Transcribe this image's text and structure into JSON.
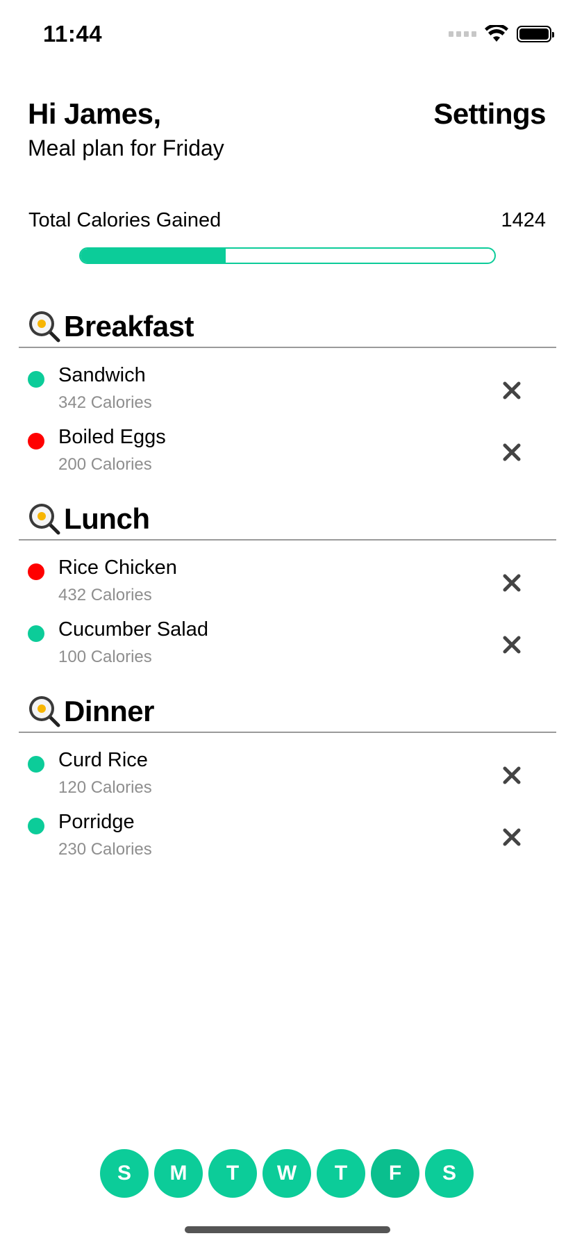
{
  "status_bar": {
    "time": "11:44"
  },
  "header": {
    "greeting": "Hi James,",
    "subtitle": "Meal plan for Friday",
    "settings_label": "Settings"
  },
  "calories": {
    "label": "Total Calories Gained",
    "value": "1424",
    "progress_percent": 35
  },
  "sections": [
    {
      "title": "Breakfast",
      "icon": "frying-pan-egg-icon",
      "items": [
        {
          "name": "Sandwich",
          "calories": "342 Calories",
          "status": "green"
        },
        {
          "name": "Boiled Eggs",
          "calories": "200 Calories",
          "status": "red"
        }
      ]
    },
    {
      "title": "Lunch",
      "icon": "frying-pan-egg-icon",
      "items": [
        {
          "name": "Rice Chicken",
          "calories": "432 Calories",
          "status": "red"
        },
        {
          "name": "Cucumber Salad",
          "calories": "100 Calories",
          "status": "green"
        }
      ]
    },
    {
      "title": "Dinner",
      "icon": "frying-pan-egg-icon",
      "items": [
        {
          "name": "Curd Rice",
          "calories": "120 Calories",
          "status": "green"
        },
        {
          "name": "Porridge",
          "calories": "230 Calories",
          "status": "green"
        }
      ]
    }
  ],
  "days": [
    "S",
    "M",
    "T",
    "W",
    "T",
    "F",
    "S"
  ],
  "selected_day_index": 5,
  "colors": {
    "accent": "#0ccc99",
    "green": "#0ccc99",
    "red": "#ff0000",
    "muted_text": "#8e8e8e"
  }
}
